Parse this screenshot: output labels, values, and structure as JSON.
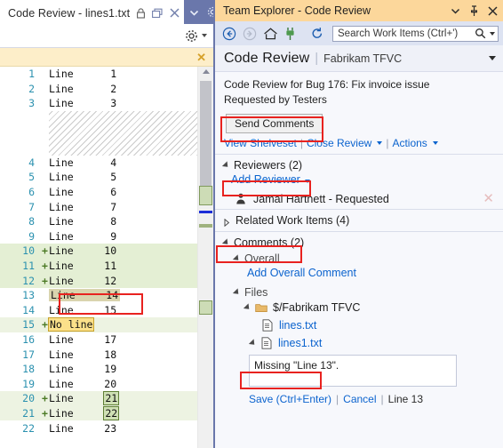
{
  "editor": {
    "tab_title": "Code Review - lines1.txt",
    "tab_icons": [
      "lock-icon",
      "float-window-icon",
      "close-icon"
    ],
    "strip_icons": [
      "chevron-down-icon",
      "gear-icon"
    ],
    "toolbar_icons": [
      "settings-gear-icon",
      "chevron-down-icon"
    ],
    "info_bar_close": "✕",
    "rows": [
      {
        "num": "1",
        "marker": "",
        "text": "Line      1",
        "state": "normal"
      },
      {
        "num": "2",
        "marker": "",
        "text": "Line      2",
        "state": "normal"
      },
      {
        "num": "3",
        "marker": "",
        "text": "Line      3",
        "state": "normal"
      },
      {
        "num": "",
        "marker": "",
        "text": "",
        "state": "gap"
      },
      {
        "num": "",
        "marker": "",
        "text": "",
        "state": "gap"
      },
      {
        "num": "",
        "marker": "",
        "text": "",
        "state": "gap"
      },
      {
        "num": "4",
        "marker": "",
        "text": "Line      4",
        "state": "normal"
      },
      {
        "num": "5",
        "marker": "",
        "text": "Line      5",
        "state": "normal"
      },
      {
        "num": "6",
        "marker": "",
        "text": "Line      6",
        "state": "normal"
      },
      {
        "num": "7",
        "marker": "",
        "text": "Line      7",
        "state": "normal"
      },
      {
        "num": "8",
        "marker": "",
        "text": "Line      8",
        "state": "normal"
      },
      {
        "num": "9",
        "marker": "",
        "text": "Line      9",
        "state": "normal"
      },
      {
        "num": "10",
        "marker": "+",
        "text": "Line     10",
        "state": "added"
      },
      {
        "num": "11",
        "marker": "+",
        "text": "Line     11",
        "state": "added"
      },
      {
        "num": "12",
        "marker": "+",
        "text": "Line     12",
        "state": "added"
      },
      {
        "num": "13",
        "marker": "",
        "text": "Line     14",
        "state": "selected"
      },
      {
        "num": "14",
        "marker": "",
        "text": "Line     15",
        "state": "normal"
      },
      {
        "num": "15",
        "marker": "+",
        "text": "No line",
        "state": "added-word"
      },
      {
        "num": "16",
        "marker": "",
        "text": "Line     17",
        "state": "normal"
      },
      {
        "num": "17",
        "marker": "",
        "text": "Line     18",
        "state": "normal"
      },
      {
        "num": "18",
        "marker": "",
        "text": "Line     19",
        "state": "normal"
      },
      {
        "num": "19",
        "marker": "",
        "text": "Line     20",
        "state": "normal"
      },
      {
        "num": "20",
        "marker": "+",
        "text": "Line     ",
        "box_text": "21",
        "state": "added-box"
      },
      {
        "num": "21",
        "marker": "+",
        "text": "Line     ",
        "box_text": "22",
        "state": "added-box"
      },
      {
        "num": "22",
        "marker": "",
        "text": "Line     23",
        "state": "normal"
      }
    ]
  },
  "team_explorer": {
    "title": "Team Explorer - Code Review",
    "title_icons": [
      "chevron-down-icon",
      "pin-icon",
      "close-icon"
    ],
    "toolbar": {
      "icons": [
        "back-icon",
        "forward-icon",
        "home-icon",
        "connect-plug-icon",
        "refresh-icon"
      ],
      "search_placeholder": "Search Work Items (Ctrl+')",
      "search_value": "",
      "search_icon": "magnifier-icon",
      "search_caret": "chevron-down-icon"
    },
    "header": {
      "title": "Code Review",
      "separator": "|",
      "subtitle": "Fabrikam TFVC",
      "menu_icon": "chevron-down-icon"
    },
    "summary": {
      "line1": "Code Review for Bug 176: Fix invoice issue",
      "line2": "Requested by Testers",
      "send_button": "Send Comments",
      "links": [
        "View Shelveset",
        "Close Review",
        "Actions"
      ]
    },
    "reviewers": {
      "header": "Reviewers (2)",
      "add_link": "Add Reviewer",
      "items": [
        {
          "icon": "person-icon",
          "label": "Jamal Hartnett - Requested",
          "remove_icon": "close-icon"
        }
      ]
    },
    "related_work_items": {
      "header": "Related Work Items (4)"
    },
    "comments": {
      "header": "Comments (2)",
      "overall": {
        "header": "Overall",
        "add_link": "Add Overall Comment"
      },
      "files": {
        "header": "Files",
        "folder": {
          "icon": "folder-icon",
          "label": "$/Fabrikam TFVC"
        },
        "items": [
          {
            "icon": "file-icon",
            "label": "lines.txt",
            "expanded": false
          },
          {
            "icon": "file-icon",
            "label": "lines1.txt",
            "expanded": true
          }
        ]
      },
      "editor": {
        "value": "Missing \"Line 13\".",
        "save_link": "Save (Ctrl+Enter)",
        "cancel_link": "Cancel",
        "location": "Line 13"
      }
    }
  },
  "annotations": {
    "color": "#e8221f",
    "boxes": [
      "send-comments",
      "add-reviewer",
      "comments-header",
      "line-13-row",
      "lines1-file"
    ]
  }
}
